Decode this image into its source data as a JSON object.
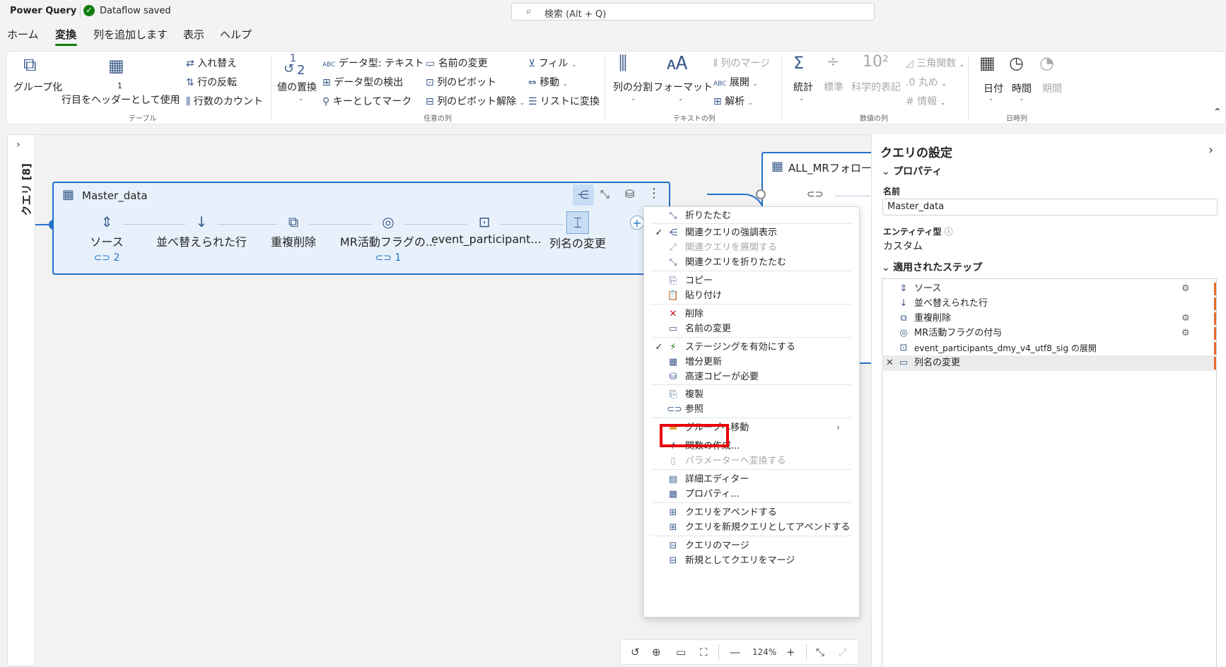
{
  "app": {
    "title": "Power Query",
    "save_status": "Dataflow saved",
    "search_placeholder": "検索 (Alt + Q)"
  },
  "tabs": [
    "ホーム",
    "変換",
    "列を追加します",
    "表示",
    "ヘルプ"
  ],
  "ribbon": {
    "table": {
      "group_by": "グループ化",
      "use_first_row_num": "1",
      "use_first_row": "行目をヘッダーとして使用",
      "transpose": "入れ替え",
      "reverse_rows": "行の反転",
      "count_rows": "行数のカウント",
      "group": "テーブル"
    },
    "any_column": {
      "replace_values_num": "1",
      "replace_values_num2": "2",
      "replace_values": "値の置換",
      "data_type": "データ型: テキスト",
      "detect_type": "データ型の検出",
      "mark_as_key": "キーとしてマーク",
      "rename": "名前の変更",
      "pivot": "列のピボット",
      "unpivot": "列のピボット解除",
      "fill": "フィル",
      "move": "移動",
      "convert_to_list": "リストに変換",
      "group": "任意の列"
    },
    "text_column": {
      "split": "列の分割",
      "format": "フォーマット",
      "merge": "列のマージ",
      "extract": "展開",
      "parse": "解析",
      "group": "テキストの列"
    },
    "number_column": {
      "statistics": "統計",
      "standard": "標準",
      "scientific": "科学的表記",
      "trig": "三角関数",
      "rounding": "丸め",
      "info": "情報",
      "group": "数値の列"
    },
    "datetime": {
      "date": "日付",
      "time": "時間",
      "duration": "期間",
      "group": "日時列"
    }
  },
  "left_pane": {
    "label": "クエリ [8]"
  },
  "card_main": {
    "title": "Master_data",
    "steps": [
      {
        "label": "ソース",
        "badge": "2"
      },
      {
        "label": "並べ替えられた行",
        "badge": ""
      },
      {
        "label": "重複削除",
        "badge": ""
      },
      {
        "label": "MR活動フラグの...",
        "badge": "1"
      },
      {
        "label": "event_participant...",
        "badge": ""
      },
      {
        "label": "列名の変更",
        "badge": ""
      }
    ]
  },
  "card_second": {
    "title": "ALL_MRフォロー"
  },
  "context_menu": [
    {
      "label": "折りたたむ",
      "check": "",
      "disabled": false
    },
    {
      "label": "関連クエリの強調表示",
      "check": "✓",
      "disabled": false
    },
    {
      "label": "関連クエリを展開する",
      "check": "",
      "disabled": true
    },
    {
      "label": "関連クエリを折りたたむ",
      "check": "",
      "disabled": false
    },
    {
      "label": "コピー",
      "check": "",
      "disabled": false
    },
    {
      "label": "貼り付け",
      "check": "",
      "disabled": false
    },
    {
      "label": "削除",
      "check": "",
      "disabled": false
    },
    {
      "label": "名前の変更",
      "check": "",
      "disabled": false
    },
    {
      "label": "ステージングを有効にする",
      "check": "✓",
      "disabled": false
    },
    {
      "label": "増分更新",
      "check": "",
      "disabled": false
    },
    {
      "label": "高速コピーが必要",
      "check": "",
      "disabled": false
    },
    {
      "label": "複製",
      "check": "",
      "disabled": false
    },
    {
      "label": "参照",
      "check": "",
      "disabled": false
    },
    {
      "label": "グループへ移動",
      "check": "",
      "disabled": false
    },
    {
      "label": "関数の作成...",
      "check": "",
      "disabled": false
    },
    {
      "label": "パラメーターへ変換する",
      "check": "",
      "disabled": true
    },
    {
      "label": "詳細エディター",
      "check": "",
      "disabled": false
    },
    {
      "label": "プロパティ...",
      "check": "",
      "disabled": false
    },
    {
      "label": "クエリをアペンドする",
      "check": "",
      "disabled": false
    },
    {
      "label": "クエリを新規クエリとしてアペンドする",
      "check": "",
      "disabled": false
    },
    {
      "label": "クエリのマージ",
      "check": "",
      "disabled": false
    },
    {
      "label": "新規としてクエリをマージ",
      "check": "",
      "disabled": false
    }
  ],
  "settings": {
    "title": "クエリの設定",
    "properties_header": "プロパティ",
    "name_label": "名前",
    "name_value": "Master_data",
    "entity_type_label": "エンティティ型",
    "entity_type_value": "カスタム",
    "applied_steps_header": "適用されたステップ",
    "applied_steps": [
      "ソース",
      "並べ替えられた行",
      "重複削除",
      "MR活動フラグの付与",
      "event_participants_dmy_v4_utf8_sig の展開",
      "列名の変更"
    ]
  },
  "zoom": {
    "level": "124%"
  }
}
